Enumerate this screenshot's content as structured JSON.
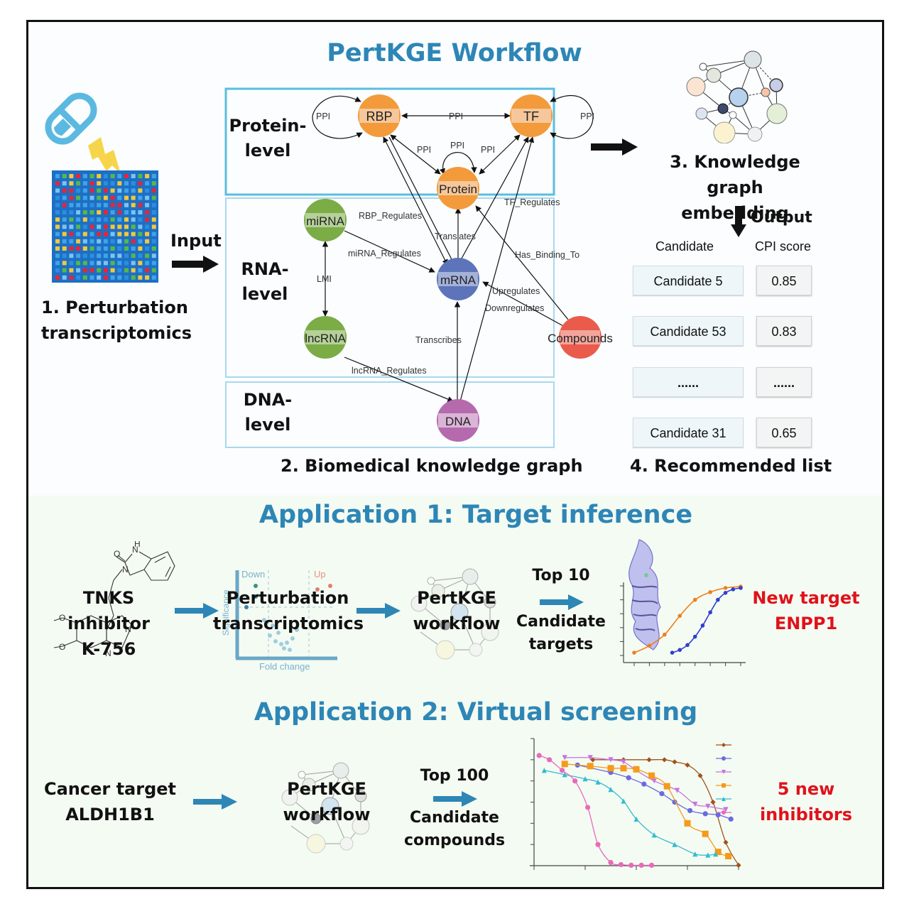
{
  "workflow": {
    "title": "PertKGE Workflow",
    "step1": {
      "line1": "1. Perturbation",
      "line2": "transcriptomics"
    },
    "input_label": "Input",
    "step2_label": "2. Biomedical knowledge graph",
    "step3": {
      "line1": "3. Knowledge graph",
      "line2": "embedding"
    },
    "output_label": "Output",
    "step4_label": "4. Recommended list",
    "levels": {
      "protein": {
        "line1": "Protein-",
        "line2": "level"
      },
      "rna": {
        "line1": "RNA-",
        "line2": "level"
      },
      "dna": {
        "line1": "DNA-",
        "line2": "level"
      }
    },
    "nodes": {
      "rbp": "RBP",
      "tf": "TF",
      "protein": "Protein",
      "mirna": "miRNA",
      "mrna": "mRNA",
      "lncrna": "lncRNA",
      "compounds": "Compounds",
      "dna": "DNA"
    },
    "node_colors": {
      "protein": "#f39a3a",
      "mirna": "#7bac46",
      "lncrna": "#7bac46",
      "mrna": "#5d74bb",
      "compounds": "#ea5b4c",
      "dna": "#b56aae"
    },
    "edges": {
      "ppi": "PPI",
      "rbp_regulates": "RBP_Regulates",
      "tf_regulates": "TF_Regulates",
      "translates": "Translates",
      "mirna_regulates": "miRNA_Regulates",
      "has_binding_to": "Has_Binding_To",
      "lmi": "LMI",
      "upregulates": "Upregulates",
      "downregulates": "Downregulates",
      "transcribes": "Transcribes",
      "lncrna_regulates": "lncRNA_Regulates"
    },
    "recommended": {
      "headers": {
        "candidate": "Candidate",
        "score": "CPI score"
      },
      "rows": [
        {
          "candidate": "Candidate 5",
          "score": "0.85"
        },
        {
          "candidate": "Candidate 53",
          "score": "0.83"
        },
        {
          "candidate": "......",
          "score": "......"
        },
        {
          "candidate": "Candidate 31",
          "score": "0.65"
        }
      ]
    }
  },
  "app1": {
    "title": "Application 1:  Target inference",
    "input": {
      "line1": "TNKS inhibitor",
      "line2": "K-756"
    },
    "volcano": {
      "line1": "Perturbation",
      "line2": "transcriptomics",
      "down": "Down",
      "up": "Up",
      "xlabel": "Fold change",
      "ylabel": "Significance"
    },
    "workflow": {
      "line1": "PertKGE",
      "line2": "workflow"
    },
    "top": {
      "line1": "Top 10",
      "line2": "Candidate",
      "line3": "targets"
    },
    "result": {
      "line1": "New target",
      "line2": "ENPP1"
    }
  },
  "app2": {
    "title": "Application 2: Virtual screening",
    "input": {
      "line1": "Cancer target",
      "line2": "ALDH1B1"
    },
    "workflow": {
      "line1": "PertKGE",
      "line2": "workflow"
    },
    "top": {
      "line1": "Top 100",
      "line2": "Candidate",
      "line3": "compounds"
    },
    "result": {
      "line1": "5 new",
      "line2": "inhibitors"
    }
  },
  "chart_data": [
    {
      "type": "line",
      "title": "",
      "xlabel": "",
      "ylabel": "",
      "xlim": [
        0,
        7
      ],
      "ylim": [
        0,
        1
      ],
      "x": [
        0,
        1,
        2,
        3,
        4,
        5,
        6,
        7
      ],
      "series": [
        {
          "name": "orange",
          "color": "#f07f1d",
          "x": [
            0,
            1,
            2,
            3,
            4,
            5,
            6,
            7
          ],
          "values": [
            0.04,
            0.14,
            0.3,
            0.57,
            0.8,
            0.91,
            0.97,
            0.99
          ]
        },
        {
          "name": "blue",
          "color": "#2f3fd0",
          "x": [
            2.5,
            3,
            3.5,
            4,
            4.5,
            5,
            5.5,
            6,
            6.5,
            7
          ],
          "values": [
            0.04,
            0.08,
            0.15,
            0.27,
            0.43,
            0.62,
            0.8,
            0.9,
            0.95,
            0.97
          ]
        }
      ]
    },
    {
      "type": "line",
      "title": "",
      "xlabel": "",
      "ylabel": "",
      "xlim": [
        0,
        8
      ],
      "ylim": [
        0,
        6
      ],
      "series": [
        {
          "name": "brown",
          "color": "#a0521c",
          "marker": "diamond",
          "x": [
            2.3,
            3.5,
            4.5,
            5.1,
            5.5,
            6.0,
            6.5,
            7.0,
            7.5,
            8.0
          ],
          "values": [
            5.0,
            5.0,
            5.0,
            5.0,
            4.9,
            4.75,
            4.25,
            3.0,
            1.1,
            0.02
          ]
        },
        {
          "name": "blue-violet",
          "color": "#6a6ae0",
          "marker": "circle",
          "x": [
            1.7,
            3.0,
            3.7,
            4.3,
            5.0,
            5.5,
            6.1,
            6.7,
            7.2,
            7.7
          ],
          "values": [
            4.75,
            4.4,
            4.15,
            3.85,
            3.4,
            3.0,
            2.6,
            2.45,
            2.4,
            2.2
          ]
        },
        {
          "name": "violet",
          "color": "#c772e2",
          "marker": "triangle-down",
          "x": [
            1.2,
            2.2,
            3.0,
            3.5,
            4.0,
            4.7,
            5.6,
            6.3,
            6.8,
            7.5
          ],
          "values": [
            5.1,
            5.1,
            5.0,
            4.9,
            4.5,
            4.0,
            3.55,
            2.9,
            2.8,
            2.65
          ]
        },
        {
          "name": "orange",
          "color": "#f59a1a",
          "marker": "square",
          "x": [
            1.2,
            2.2,
            3.0,
            3.5,
            4.0,
            4.6,
            5.2,
            6.0,
            6.7,
            7.2,
            7.6
          ],
          "values": [
            4.8,
            4.7,
            4.6,
            4.6,
            4.55,
            4.25,
            3.75,
            2.0,
            1.5,
            0.65,
            0.45
          ]
        },
        {
          "name": "cyan",
          "color": "#33bcd0",
          "marker": "triangle-up",
          "x": [
            0.4,
            1.2,
            2.0,
            2.5,
            3.0,
            3.5,
            4.0,
            4.7,
            5.5,
            6.3,
            6.8,
            7.1
          ],
          "values": [
            4.5,
            4.3,
            4.1,
            3.95,
            3.6,
            3.05,
            2.2,
            1.45,
            1.0,
            0.55,
            0.5,
            0.55
          ]
        },
        {
          "name": "pink",
          "color": "#e86aba",
          "marker": "circle",
          "x": [
            0.2,
            0.6,
            1.1,
            1.6,
            2.1,
            2.5,
            3.0,
            3.4,
            3.8,
            4.2,
            4.6
          ],
          "values": [
            5.2,
            5.0,
            4.5,
            4.0,
            2.75,
            1.0,
            0.15,
            0.05,
            0.02,
            0.02,
            0.02
          ]
        }
      ]
    }
  ]
}
